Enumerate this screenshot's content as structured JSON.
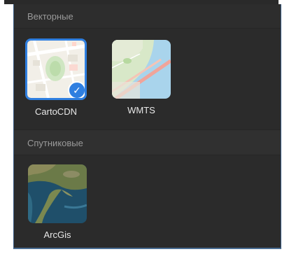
{
  "sections": [
    {
      "title": "Векторные",
      "items": [
        {
          "label": "CartoCDN",
          "selected": true
        },
        {
          "label": "WMTS",
          "selected": false
        }
      ]
    },
    {
      "title": "Спутниковые",
      "items": [
        {
          "label": "ArcGis",
          "selected": false
        }
      ]
    }
  ],
  "colors": {
    "accent": "#2f7fe0",
    "panel_bg": "#2b2b2b",
    "header_text": "#9a9a9a",
    "label_text": "#e8e8e8"
  }
}
